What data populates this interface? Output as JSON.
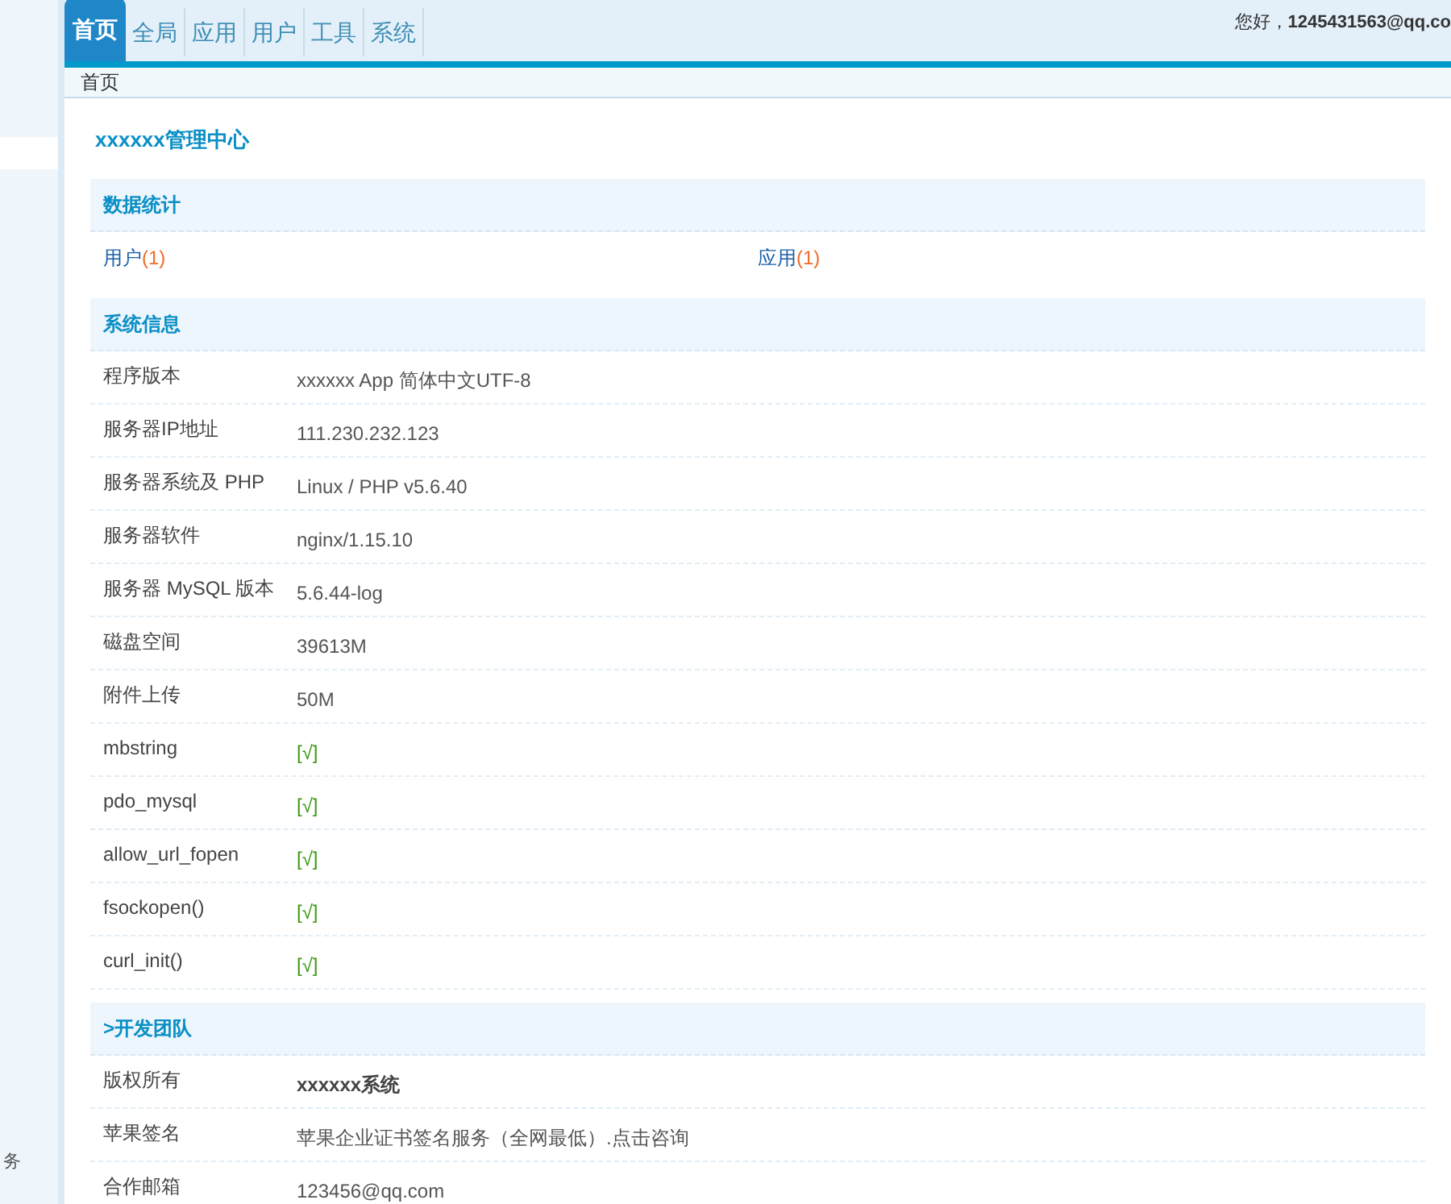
{
  "header": {
    "tabs": [
      {
        "label": "首页",
        "selected": true
      },
      {
        "label": "全局",
        "selected": false
      },
      {
        "label": "应用",
        "selected": false
      },
      {
        "label": "用户",
        "selected": false
      },
      {
        "label": "工具",
        "selected": false
      },
      {
        "label": "系统",
        "selected": false
      }
    ],
    "greeting": "您好，**1245431563@qq.co**"
  },
  "sidebar": {
    "fragment": "务"
  },
  "breadcrumb": "首页",
  "page_title": "xxxxxx管理中心",
  "stats": {
    "title": "数据统计",
    "items": [
      {
        "label": "用户",
        "count": "(1)"
      },
      {
        "label": "应用",
        "count": "(1)"
      }
    ]
  },
  "sections": [
    {
      "title": "系统信息",
      "rows": [
        {
          "label": "程序版本",
          "value": "xxxxxx App 简体中文UTF-8",
          "kind": "text"
        },
        {
          "label": "服务器IP地址",
          "value": "111.230.232.123",
          "kind": "text"
        },
        {
          "label": "服务器系统及 PHP",
          "value": "Linux / PHP v5.6.40",
          "kind": "text"
        },
        {
          "label": "服务器软件",
          "value": "nginx/1.15.10",
          "kind": "text"
        },
        {
          "label": "服务器 MySQL 版本",
          "value": "5.6.44-log",
          "kind": "text"
        },
        {
          "label": "磁盘空间",
          "value": "39613M",
          "kind": "text"
        },
        {
          "label": "附件上传",
          "value": "50M",
          "kind": "text"
        },
        {
          "label": "mbstring",
          "value": "[√]",
          "kind": "check"
        },
        {
          "label": "pdo_mysql",
          "value": "[√]",
          "kind": "check"
        },
        {
          "label": "allow_url_fopen",
          "value": "[√]",
          "kind": "check"
        },
        {
          "label": "fsockopen()",
          "value": "[√]",
          "kind": "check"
        },
        {
          "label": "curl_init()",
          "value": "[√]",
          "kind": "check"
        }
      ]
    },
    {
      "title": ">开发团队",
      "rows": [
        {
          "label": "版权所有",
          "value": "xxxxxx系统",
          "kind": "bold"
        },
        {
          "label": "苹果签名",
          "value": "苹果企业证书签名服务（全网最低）.点击咨询",
          "kind": "text"
        },
        {
          "label": "合作邮箱",
          "value": "123456@qq.com",
          "kind": "text"
        }
      ]
    }
  ]
}
